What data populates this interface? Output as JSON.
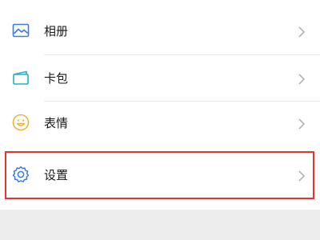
{
  "menu": {
    "items": [
      {
        "label": "相册",
        "icon": "photo-album-icon",
        "icon_color": "#3c7be0"
      },
      {
        "label": "卡包",
        "icon": "card-wallet-icon",
        "icon_color": "#20b2c4"
      },
      {
        "label": "表情",
        "icon": "emoji-smile-icon",
        "icon_color": "#e9b53d"
      },
      {
        "label": "设置",
        "icon": "gear-icon",
        "icon_color": "#3c7be0"
      }
    ]
  },
  "highlight": {
    "target": "设置",
    "color": "#e8342e"
  }
}
